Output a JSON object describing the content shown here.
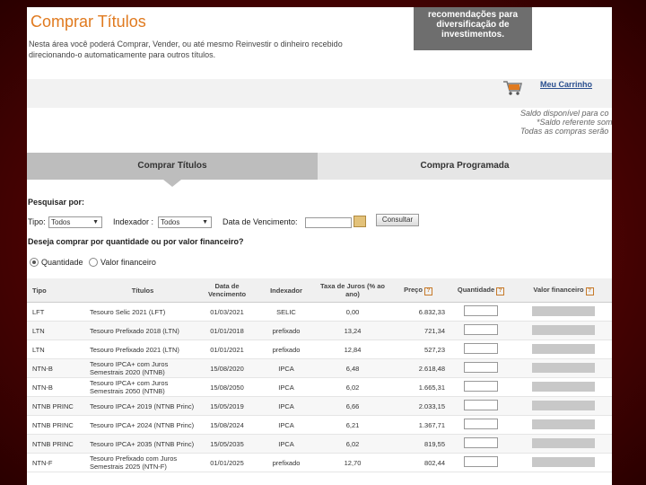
{
  "banner": {
    "text": "recomendações para diversificação de investimentos."
  },
  "page_title": "Comprar Títulos",
  "intro": "Nesta área você poderá Comprar, Vender, ou até mesmo Reinvestir o dinheiro recebido direcionando-o automaticamente para outros títulos.",
  "cart": {
    "label": "Meu Carrinho"
  },
  "saldo": {
    "line1": "Saldo disponível para co",
    "line2": "*Saldo referente som",
    "line3": "Todas as compras serão"
  },
  "tabs": {
    "tab1": "Comprar Títulos",
    "tab2": "Compra Programada"
  },
  "search": {
    "heading": "Pesquisar por:",
    "tipo_label": "Tipo:",
    "tipo_value": "Todos",
    "indexador_label": "Indexador :",
    "indexador_value": "Todos",
    "vencimento_label": "Data de Vencimento:",
    "consultar": "Consultar"
  },
  "buy_mode": {
    "question": "Deseja comprar por quantidade ou por valor financeiro?",
    "opt1": "Quantidade",
    "opt2": "Valor financeiro"
  },
  "table": {
    "headers": [
      "Tipo",
      "Títulos",
      "Data de Vencimento",
      "Indexador",
      "Taxa de Juros (% ao ano)",
      "Preço",
      "Quantidade",
      "Valor financeiro"
    ],
    "rows": [
      [
        "LFT",
        "Tesouro Selic 2021 (LFT)",
        "01/03/2021",
        "SELIC",
        "0,00",
        "6.832,33"
      ],
      [
        "LTN",
        "Tesouro Prefixado 2018 (LTN)",
        "01/01/2018",
        "prefixado",
        "13,24",
        "721,34"
      ],
      [
        "LTN",
        "Tesouro Prefixado 2021 (LTN)",
        "01/01/2021",
        "prefixado",
        "12,84",
        "527,23"
      ],
      [
        "NTN-B",
        "Tesouro IPCA+ com Juros Semestrais 2020 (NTNB)",
        "15/08/2020",
        "IPCA",
        "6,48",
        "2.618,48"
      ],
      [
        "NTN-B",
        "Tesouro IPCA+ com Juros Semestrais 2050 (NTNB)",
        "15/08/2050",
        "IPCA",
        "6,02",
        "1.665,31"
      ],
      [
        "NTNB PRINC",
        "Tesouro IPCA+ 2019 (NTNB Princ)",
        "15/05/2019",
        "IPCA",
        "6,66",
        "2.033,15"
      ],
      [
        "NTNB PRINC",
        "Tesouro IPCA+ 2024 (NTNB Princ)",
        "15/08/2024",
        "IPCA",
        "6,21",
        "1.367,71"
      ],
      [
        "NTNB PRINC",
        "Tesouro IPCA+ 2035 (NTNB Princ)",
        "15/05/2035",
        "IPCA",
        "6,02",
        "819,55"
      ],
      [
        "NTN-F",
        "Tesouro Prefixado com Juros Semestrais 2025 (NTN-F)",
        "01/01/2025",
        "prefixado",
        "12,70",
        "802,44"
      ]
    ]
  },
  "colors": {
    "title": "#e07a1f",
    "link": "#2a4f8f",
    "background": "#5a0606"
  }
}
